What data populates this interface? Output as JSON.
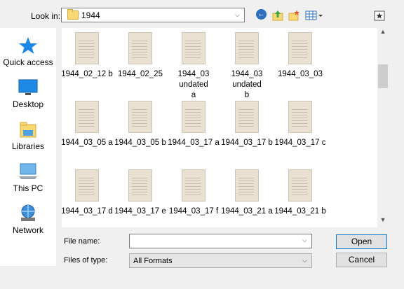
{
  "toolbar": {
    "look_in_label": "Look in:",
    "look_in_value": "1944"
  },
  "places": [
    {
      "label": "Quick access",
      "icon": "star-icon"
    },
    {
      "label": "Desktop",
      "icon": "desktop-icon"
    },
    {
      "label": "Libraries",
      "icon": "libraries-icon"
    },
    {
      "label": "This PC",
      "icon": "computer-icon"
    },
    {
      "label": "Network",
      "icon": "network-icon"
    }
  ],
  "files": [
    {
      "label": "1944_02_12 b"
    },
    {
      "label": "1944_02_25"
    },
    {
      "label": "1944_03 undated a"
    },
    {
      "label": "1944_03 undated b"
    },
    {
      "label": "1944_03_03"
    },
    {
      "label": "1944_03_05 a"
    },
    {
      "label": "1944_03_05 b"
    },
    {
      "label": "1944_03_17 a"
    },
    {
      "label": "1944_03_17 b"
    },
    {
      "label": "1944_03_17 c"
    },
    {
      "label": "1944_03_17 d"
    },
    {
      "label": "1944_03_17 e"
    },
    {
      "label": "1944_03_17 f"
    },
    {
      "label": "1944_03_21 a"
    },
    {
      "label": "1944_03_21 b"
    }
  ],
  "bottom": {
    "file_name_label": "File name:",
    "file_name_value": "",
    "file_type_label": "Files of type:",
    "file_type_value": "All Formats",
    "open_label": "Open",
    "cancel_label": "Cancel"
  },
  "colors": {
    "accent": "#0078d7",
    "folder": "#f8d775"
  }
}
